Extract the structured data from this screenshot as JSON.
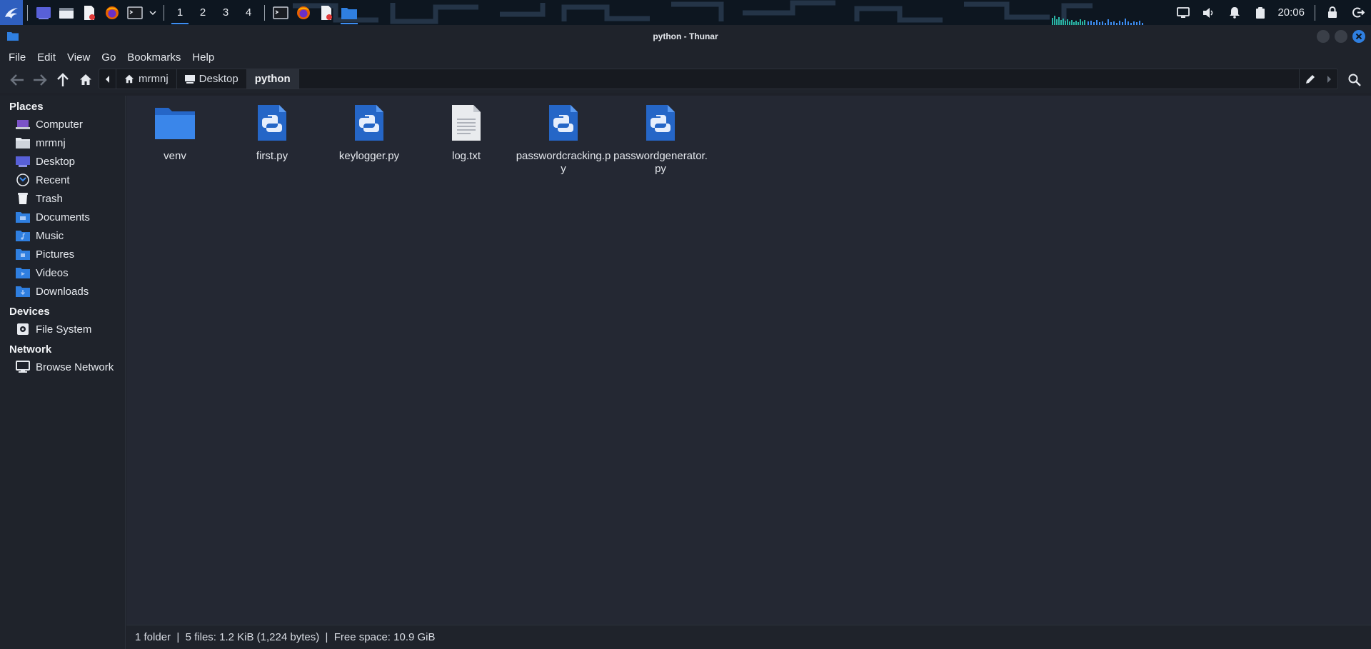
{
  "panel": {
    "workspaces": [
      "1",
      "2",
      "3",
      "4"
    ],
    "active_workspace": "1",
    "clock": "20:06",
    "accent": "#3d8df2"
  },
  "window": {
    "title": "python - Thunar"
  },
  "menubar": {
    "items": [
      "File",
      "Edit",
      "View",
      "Go",
      "Bookmarks",
      "Help"
    ]
  },
  "toolbar": {
    "icons": [
      "back-icon",
      "forward-icon",
      "up-icon",
      "home-icon"
    ],
    "breadcrumbs": [
      {
        "label": "mrmnj",
        "icon": "home-icon"
      },
      {
        "label": "Desktop",
        "icon": "desktop-icon"
      },
      {
        "label": "python",
        "icon": ""
      }
    ]
  },
  "sidebar": {
    "places_header": "Places",
    "places": [
      {
        "label": "Computer",
        "icon": "computer-icon"
      },
      {
        "label": "mrmnj",
        "icon": "home-folder-icon"
      },
      {
        "label": "Desktop",
        "icon": "desktop-icon"
      },
      {
        "label": "Recent",
        "icon": "recent-icon"
      },
      {
        "label": "Trash",
        "icon": "trash-icon"
      },
      {
        "label": "Documents",
        "icon": "documents-folder-icon"
      },
      {
        "label": "Music",
        "icon": "music-folder-icon"
      },
      {
        "label": "Pictures",
        "icon": "pictures-folder-icon"
      },
      {
        "label": "Videos",
        "icon": "videos-folder-icon"
      },
      {
        "label": "Downloads",
        "icon": "downloads-folder-icon"
      }
    ],
    "devices_header": "Devices",
    "devices": [
      {
        "label": "File System",
        "icon": "drive-icon"
      }
    ],
    "network_header": "Network",
    "network": [
      {
        "label": "Browse Network",
        "icon": "network-icon"
      }
    ]
  },
  "files": [
    {
      "name": "venv",
      "type": "folder-icon"
    },
    {
      "name": "first.py",
      "type": "python-file-icon"
    },
    {
      "name": "keylogger.py",
      "type": "python-file-icon"
    },
    {
      "name": "log.txt",
      "type": "text-file-icon"
    },
    {
      "name": "passwordcracking.py",
      "type": "python-file-icon"
    },
    {
      "name": "passwordgenerator.py",
      "type": "python-file-icon"
    }
  ],
  "statusbar": {
    "text": "1 folder  |  5 files: 1.2 KiB (1,224 bytes)  |  Free space: 10.9 GiB"
  }
}
